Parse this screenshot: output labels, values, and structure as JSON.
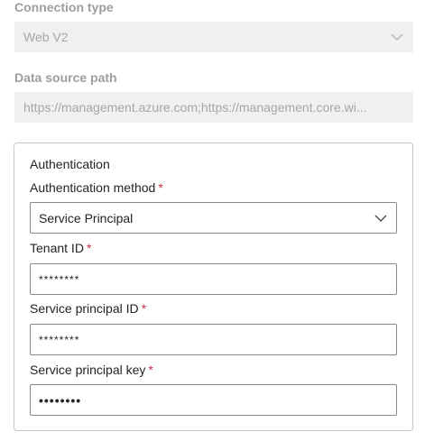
{
  "connection_type": {
    "label": "Connection type",
    "value": "Web V2"
  },
  "data_source_path": {
    "label": "Data source path",
    "value": "https://management.azure.com;https://management.core.wi..."
  },
  "authentication": {
    "title": "Authentication",
    "method": {
      "label": "Authentication method",
      "required_mark": "*",
      "value": "Service Principal"
    },
    "tenant_id": {
      "label": "Tenant ID",
      "required_mark": "*",
      "value": "********"
    },
    "service_principal_id": {
      "label": "Service principal ID",
      "required_mark": "*",
      "value": "********"
    },
    "service_principal_key": {
      "label": "Service principal key",
      "required_mark": "*",
      "value": "••••••••"
    }
  },
  "colors": {
    "required": "#c4314b",
    "disabled_bg": "#f0f0f0",
    "disabled_text": "#a6a6a6"
  },
  "icons": {
    "dropdown": "chevron-down-icon"
  }
}
